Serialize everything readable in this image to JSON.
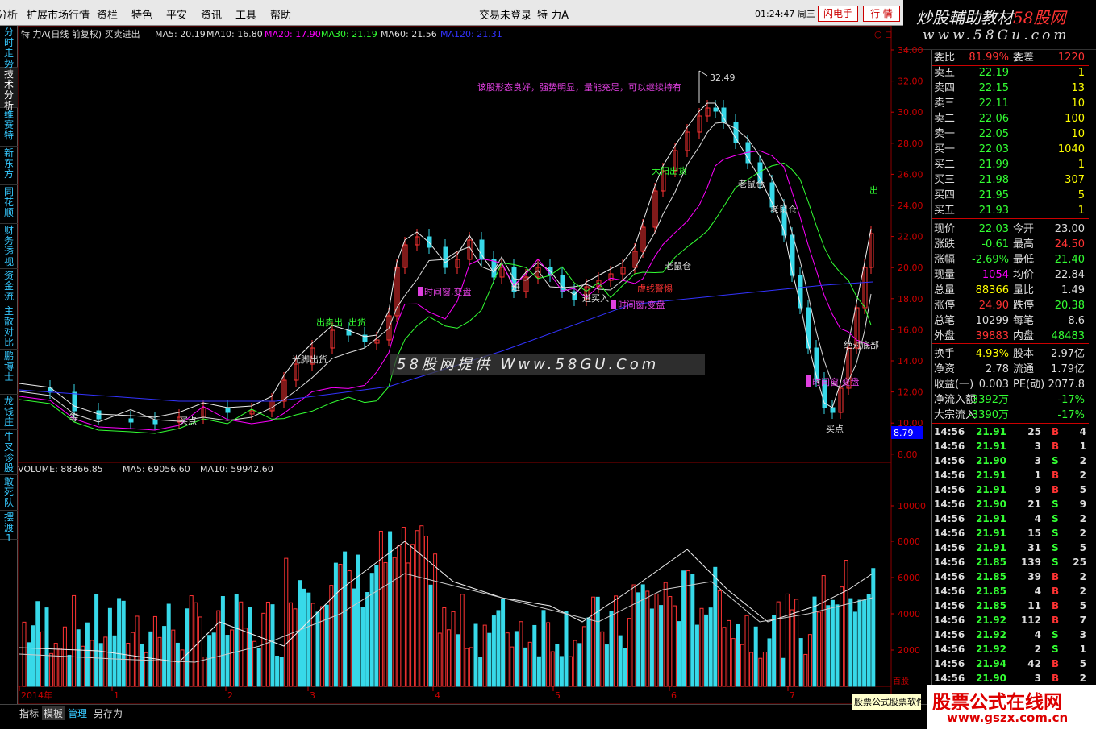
{
  "menu": {
    "items": [
      "分析",
      "扩展市场行情",
      "资栏",
      "特色",
      "平安",
      "资讯",
      "工具",
      "帮助"
    ],
    "center": "交易未登录",
    "stock_name": "特 力A",
    "clock": "01:24:47",
    "weekday": "周三",
    "btn_flash": "闪电手",
    "btn_quote": "行 情"
  },
  "brand": {
    "title_a": "炒股輔助教材",
    "title_b": "58股网",
    "url": "www.58Gu.com"
  },
  "sidebar": {
    "tabs": [
      "分时走势",
      "技术分析",
      "维赛特",
      "新东方",
      "同花顺",
      "财务透视",
      "资金流",
      "主散对比",
      "鹏博士",
      "龙钱庄",
      "牛叉诊股",
      "敢死队",
      "摆渡1"
    ]
  },
  "chart": {
    "legend": {
      "title": "特 力A(日线 前复权) 买卖进出",
      "ma5": "MA5: 20.19",
      "ma10": "MA10: 16.80",
      "ma20": "MA20: 17.90",
      "ma30": "MA30: 21.19",
      "ma60": "MA60: 21.56",
      "ma120": "MA120: 21.31"
    },
    "price_axis": [
      "34.00",
      "32.00",
      "30.00",
      "28.00",
      "26.00",
      "24.00",
      "22.00",
      "20.00",
      "18.00",
      "16.00",
      "14.00",
      "12.00",
      "10.00",
      "8.00"
    ],
    "current_tag": "8.79",
    "vol_legend": {
      "vol": "VOLUME: 88366.85",
      "ma5": "MA5: 69056.60",
      "ma10": "MA10: 59942.60"
    },
    "vol_axis": [
      "10000",
      "8000",
      "6000",
      "4000",
      "2000"
    ],
    "vol_unit": "百股",
    "x_labels": [
      "2014年",
      "1",
      "2",
      "3",
      "4",
      "5",
      "6",
      "7"
    ],
    "corner": "○ ◻",
    "annotations": {
      "high": "32.49",
      "comment": "该股形态良好，强势明显，量能充足，可以继续持有",
      "a_kouzi": "出",
      "a_daduan": "大阳出货",
      "a_laoshu": "老鼠仓",
      "a_laoshu2": "老鼠仓",
      "a_laoshu3": "老鼠仓",
      "a_time1": "时间窗,变盘",
      "a_time2": "时间窗,变盘",
      "a_time3": "时间窗,变盘",
      "a_jueduidi": "绝对底部",
      "a_maidian": "买点",
      "a_maidian2": "买点",
      "a_jinmairu": "进买入",
      "a_xuxian": "虚线警惕",
      "a_jin": "进",
      "a_chu": "出",
      "a_chuhuo": "出货",
      "a_chumaichu": "出卖出",
      "a_guangjiao": "光脚出货",
      "a_deng": "等"
    }
  },
  "watermark": "58股网提供 Www.58GU.Com",
  "quote": {
    "rows": [
      {
        "l": "委比",
        "v": "81.99%",
        "l2": "委差",
        "v2": "1220"
      },
      {
        "l": "卖五",
        "v": "22.19",
        "v2": "1"
      },
      {
        "l": "卖四",
        "v": "22.15",
        "v2": "13"
      },
      {
        "l": "卖三",
        "v": "22.11",
        "v2": "10"
      },
      {
        "l": "卖二",
        "v": "22.06",
        "v2": "100"
      },
      {
        "l": "卖一",
        "v": "22.05",
        "v2": "10"
      },
      {
        "l": "买一",
        "v": "22.03",
        "v2": "1040"
      },
      {
        "l": "买二",
        "v": "21.99",
        "v2": "1"
      },
      {
        "l": "买三",
        "v": "21.98",
        "v2": "307"
      },
      {
        "l": "买四",
        "v": "21.95",
        "v2": "5"
      },
      {
        "l": "买五",
        "v": "21.93",
        "v2": "1"
      },
      {
        "l": "现价",
        "v": "22.03",
        "l2": "今开",
        "v2": "23.00"
      },
      {
        "l": "涨跌",
        "v": "-0.61",
        "l2": "最高",
        "v2": "24.50"
      },
      {
        "l": "涨幅",
        "v": "-2.69%",
        "l2": "最低",
        "v2": "21.40"
      },
      {
        "l": "现量",
        "v": "1054",
        "l2": "均价",
        "v2": "22.84"
      },
      {
        "l": "总量",
        "v": "88366",
        "l2": "量比",
        "v2": "1.49"
      },
      {
        "l": "涨停",
        "v": "24.90",
        "l2": "跌停",
        "v2": "20.38"
      },
      {
        "l": "总笔",
        "v": "10299",
        "l2": "每笔",
        "v2": "8.6"
      },
      {
        "l": "外盘",
        "v": "39883",
        "l2": "内盘",
        "v2": "48483"
      },
      {
        "l": "换手",
        "v": "4.93%",
        "l2": "股本",
        "v2": "2.97亿"
      },
      {
        "l": "净资",
        "v": "2.78",
        "l2": "流通",
        "v2": "1.79亿"
      },
      {
        "l": "收益(一)",
        "v": "0.003",
        "l2": "PE(动)",
        "v2": "2077.8"
      },
      {
        "l": "净流入额",
        "v": "-3392万",
        "v2": "-17%"
      },
      {
        "l": "大宗流入",
        "v": "-3390万",
        "v2": "-17%"
      }
    ],
    "trades": [
      {
        "t": "14:56",
        "p": "21.91",
        "q": "25",
        "s": "B",
        "n": "4"
      },
      {
        "t": "14:56",
        "p": "21.91",
        "q": "3",
        "s": "B",
        "n": "1"
      },
      {
        "t": "14:56",
        "p": "21.90",
        "q": "3",
        "s": "S",
        "n": "2"
      },
      {
        "t": "14:56",
        "p": "21.91",
        "q": "1",
        "s": "B",
        "n": "2"
      },
      {
        "t": "14:56",
        "p": "21.91",
        "q": "9",
        "s": "B",
        "n": "5"
      },
      {
        "t": "14:56",
        "p": "21.90",
        "q": "21",
        "s": "S",
        "n": "9"
      },
      {
        "t": "14:56",
        "p": "21.91",
        "q": "4",
        "s": "S",
        "n": "2"
      },
      {
        "t": "14:56",
        "p": "21.91",
        "q": "15",
        "s": "S",
        "n": "2"
      },
      {
        "t": "14:56",
        "p": "21.91",
        "q": "31",
        "s": "S",
        "n": "5"
      },
      {
        "t": "14:56",
        "p": "21.85",
        "q": "139",
        "s": "S",
        "n": "25"
      },
      {
        "t": "14:56",
        "p": "21.85",
        "q": "39",
        "s": "B",
        "n": "2"
      },
      {
        "t": "14:56",
        "p": "21.85",
        "q": "4",
        "s": "B",
        "n": "2"
      },
      {
        "t": "14:56",
        "p": "21.85",
        "q": "11",
        "s": "B",
        "n": "5"
      },
      {
        "t": "14:56",
        "p": "21.92",
        "q": "112",
        "s": "B",
        "n": "7"
      },
      {
        "t": "14:56",
        "p": "21.92",
        "q": "4",
        "s": "S",
        "n": "3"
      },
      {
        "t": "14:56",
        "p": "21.92",
        "q": "2",
        "s": "S",
        "n": "1"
      },
      {
        "t": "14:56",
        "p": "21.94",
        "q": "42",
        "s": "B",
        "n": "5"
      },
      {
        "t": "14:56",
        "p": "21.90",
        "q": "3",
        "s": "B",
        "n": "2"
      }
    ]
  },
  "bottom": {
    "tabs": [
      "指标",
      "模板",
      "管理",
      "另存为"
    ],
    "formula": "股票公式股票软件"
  },
  "gsz": {
    "title": "股票公式在线网",
    "url": "www.gszx.com.cn"
  }
}
